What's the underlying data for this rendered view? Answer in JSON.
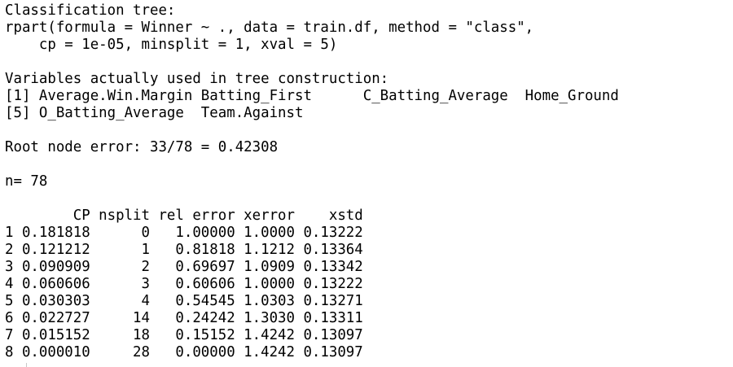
{
  "console": {
    "header_title": "Classification tree:",
    "call_line1": "rpart(formula = Winner ~ ., data = train.df, method = \"class\",",
    "call_line2": "    cp = 1e-05, minsplit = 1, xval = 5)",
    "vars_title": "Variables actually used in tree construction:",
    "vars_line1": "[1] Average.Win.Margin Batting_First      C_Batting_Average  Home_Ground",
    "vars_line2": "[5] O_Batting_Average  Team.Against",
    "root_error": "Root node error: 33/78 = 0.42308",
    "n_line": "n= 78",
    "table_header": "        CP nsplit rel error xerror    xstd",
    "rows": [
      "1 0.181818      0   1.00000 1.0000 0.13222",
      "2 0.121212      1   0.81818 1.1212 0.13364",
      "3 0.090909      2   0.69697 1.0909 0.13342",
      "4 0.060606      3   0.60606 1.0000 0.13222",
      "5 0.030303      4   0.54545 1.0303 0.13271",
      "6 0.022727     14   0.24242 1.3030 0.13311",
      "7 0.015152     18   0.15152 1.4242 0.13097",
      "8 0.000010     28   0.00000 1.4242 0.13097"
    ]
  }
}
